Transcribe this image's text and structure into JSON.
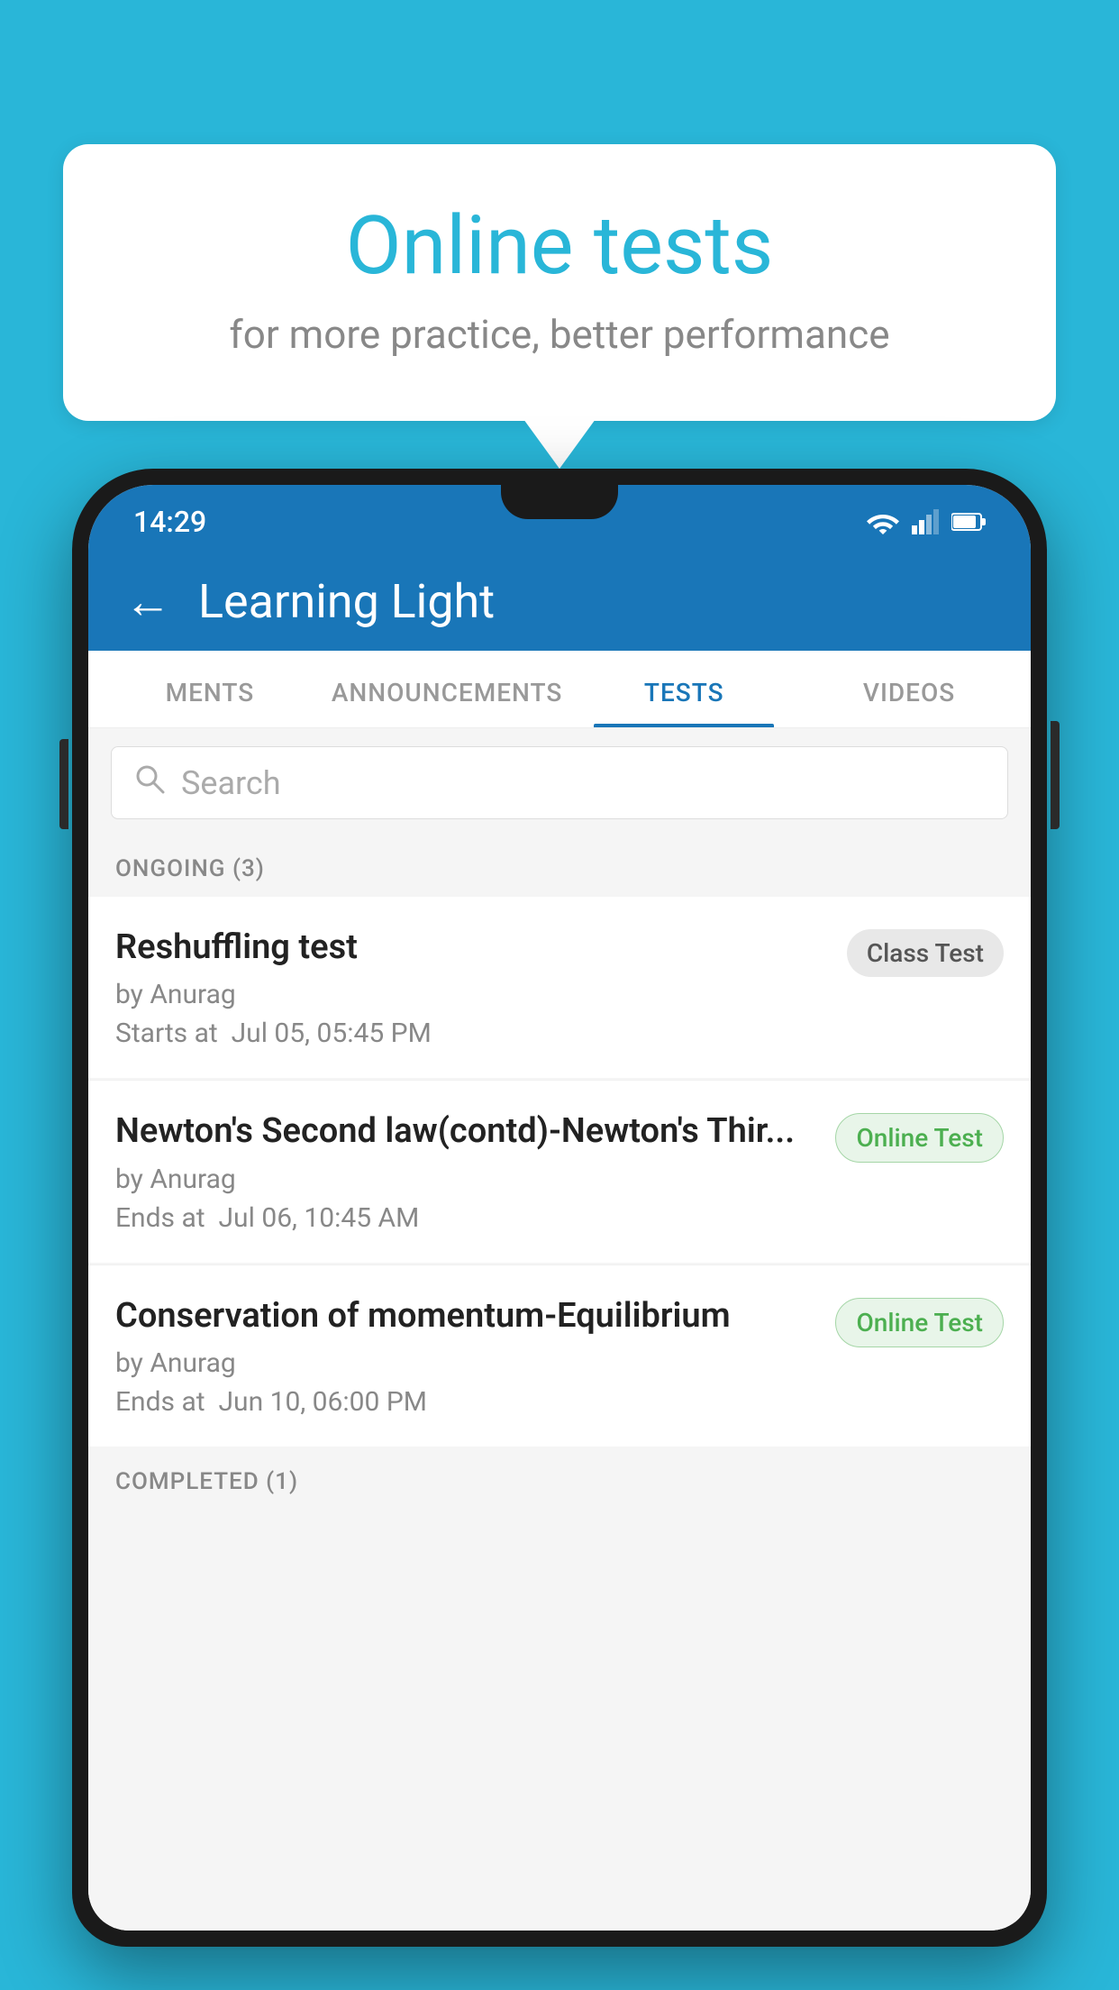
{
  "background": {
    "color": "#29B6D8"
  },
  "speech_bubble": {
    "title": "Online tests",
    "subtitle": "for more practice, better performance"
  },
  "status_bar": {
    "time": "14:29"
  },
  "app_header": {
    "title": "Learning Light",
    "back_label": "←"
  },
  "tabs": [
    {
      "label": "MENTS",
      "active": false
    },
    {
      "label": "ANNOUNCEMENTS",
      "active": false
    },
    {
      "label": "TESTS",
      "active": true
    },
    {
      "label": "VIDEOS",
      "active": false
    }
  ],
  "search": {
    "placeholder": "Search"
  },
  "ongoing_section": {
    "header": "ONGOING (3)",
    "items": [
      {
        "title": "Reshuffling test",
        "by": "by Anurag",
        "time_label": "Starts at",
        "time_value": "Jul 05, 05:45 PM",
        "badge": "Class Test",
        "badge_type": "class"
      },
      {
        "title": "Newton's Second law(contd)-Newton's Thir...",
        "by": "by Anurag",
        "time_label": "Ends at",
        "time_value": "Jul 06, 10:45 AM",
        "badge": "Online Test",
        "badge_type": "online"
      },
      {
        "title": "Conservation of momentum-Equilibrium",
        "by": "by Anurag",
        "time_label": "Ends at",
        "time_value": "Jun 10, 06:00 PM",
        "badge": "Online Test",
        "badge_type": "online"
      }
    ]
  },
  "completed_section": {
    "header": "COMPLETED (1)"
  }
}
